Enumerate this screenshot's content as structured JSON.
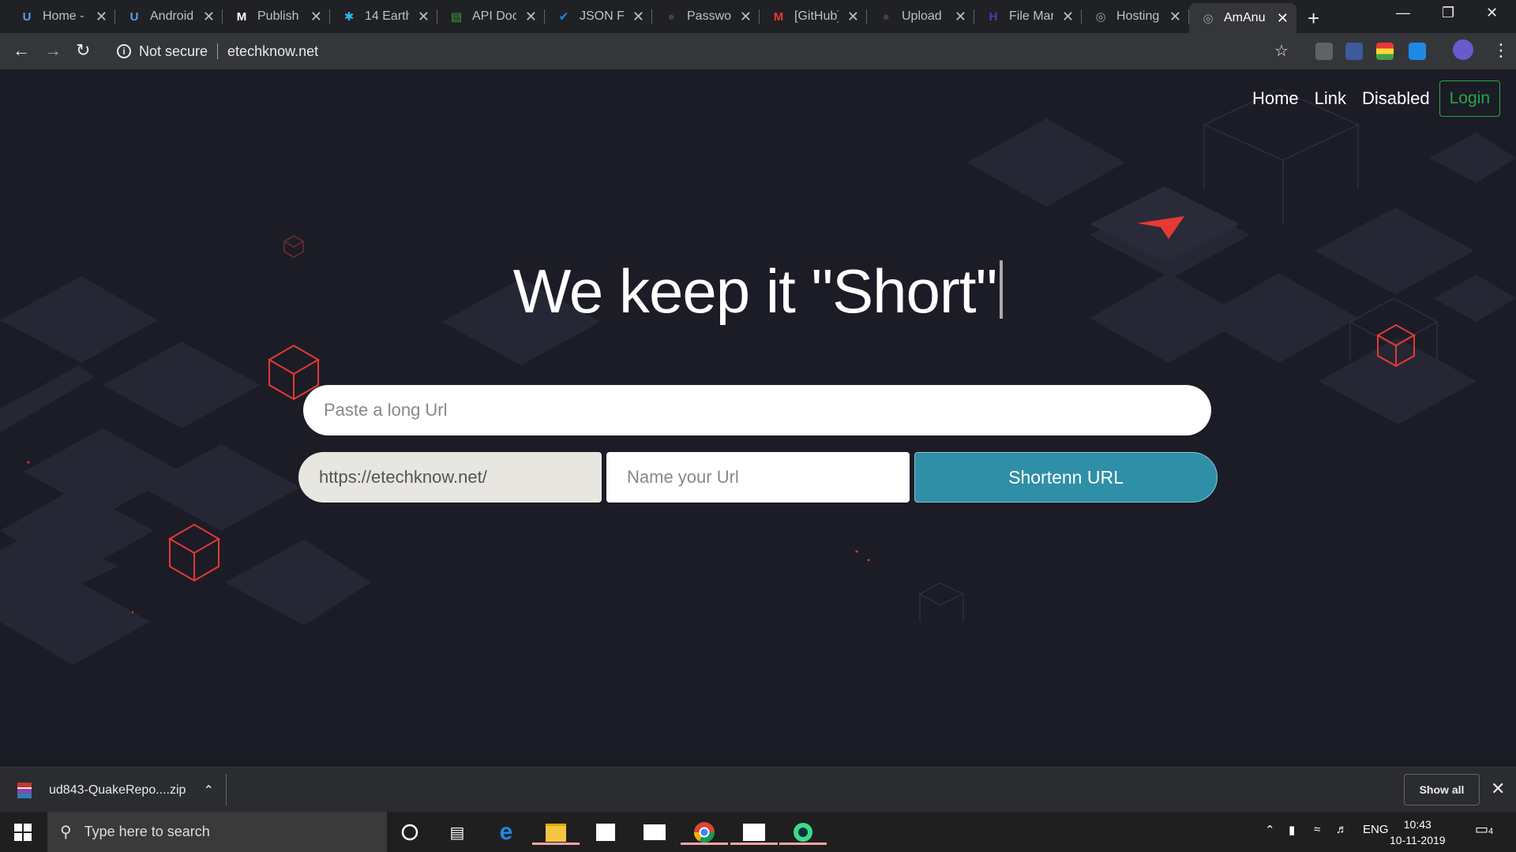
{
  "browser": {
    "tabs": [
      {
        "title": "Home -",
        "icon": "udemy-icon"
      },
      {
        "title": "Android",
        "icon": "udemy-icon"
      },
      {
        "title": "Publish",
        "icon": "medium-icon"
      },
      {
        "title": "14 Earth",
        "icon": "puzzle-icon"
      },
      {
        "title": "API Doc",
        "icon": "doc-icon"
      },
      {
        "title": "JSON Fo",
        "icon": "check-icon"
      },
      {
        "title": "Passwor",
        "icon": "github-icon"
      },
      {
        "title": "[GitHub]",
        "icon": "gmail-icon"
      },
      {
        "title": "Upload",
        "icon": "github-icon"
      },
      {
        "title": "File Man",
        "icon": "filemanager-icon"
      },
      {
        "title": "Hosting",
        "icon": "globe-icon"
      },
      {
        "title": "AmAnu",
        "icon": "globe-icon",
        "active": true
      }
    ],
    "security_label": "Not secure",
    "url": "etechknow.net"
  },
  "page": {
    "nav": {
      "home": "Home",
      "link": "Link",
      "disabled": "Disabled",
      "login": "Login"
    },
    "headline": "We keep it \"Short\"",
    "long_url_placeholder": "Paste a long Url",
    "prefix": "https://etechknow.net/",
    "name_placeholder": "Name your Url",
    "shorten_label": "Shortenn URL"
  },
  "downloads": {
    "file_name": "ud843-QuakeRepo....zip",
    "show_all": "Show all"
  },
  "taskbar": {
    "search_placeholder": "Type here to search",
    "language": "ENG",
    "time": "10:43",
    "date": "10-11-2019",
    "notification_count": "4"
  },
  "colors": {
    "page_bg": "#1b1c26",
    "accent_button": "#2f8fa6",
    "login_green": "#28a745",
    "cube_red": "#e53935"
  }
}
